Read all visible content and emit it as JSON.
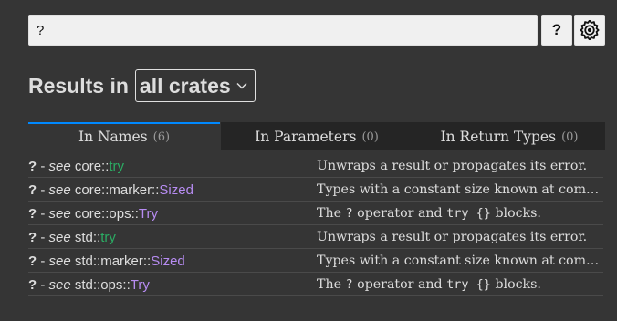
{
  "search": {
    "value": "?",
    "help_label": "?"
  },
  "heading": {
    "prefix": "Results in",
    "crate_filter": "all crates"
  },
  "tabs": [
    {
      "label": "In Names",
      "count": "(6)",
      "selected": true
    },
    {
      "label": "In Parameters",
      "count": "(0)",
      "selected": false
    },
    {
      "label": "In Return Types",
      "count": "(0)",
      "selected": false
    }
  ],
  "results": [
    {
      "name": "?",
      "see": "see",
      "module": "core::",
      "item": "try",
      "kind": "fn",
      "desc": "Unwraps a result or propagates its error."
    },
    {
      "name": "?",
      "see": "see",
      "module": "core::marker::",
      "item": "Sized",
      "kind": "trait",
      "desc": "Types with a constant size known at comp..."
    },
    {
      "name": "?",
      "see": "see",
      "module": "core::ops::",
      "item": "Try",
      "kind": "trait",
      "desc_pre": "The ",
      "desc_code1": "?",
      "desc_mid": " operator and ",
      "desc_code2": "try {}",
      "desc_post": " blocks."
    },
    {
      "name": "?",
      "see": "see",
      "module": "std::",
      "item": "try",
      "kind": "fn",
      "desc": "Unwraps a result or propagates its error."
    },
    {
      "name": "?",
      "see": "see",
      "module": "std::marker::",
      "item": "Sized",
      "kind": "trait",
      "desc": "Types with a constant size known at comp..."
    },
    {
      "name": "?",
      "see": "see",
      "module": "std::ops::",
      "item": "Try",
      "kind": "trait",
      "desc_pre": "The ",
      "desc_code1": "?",
      "desc_mid": " operator and ",
      "desc_code2": "try {}",
      "desc_post": " blocks."
    }
  ],
  "colors": {
    "background": "#353535",
    "fn": "#2bab63",
    "trait": "#b78cf2",
    "tab_active": "#0089ff"
  },
  "icons": {
    "settings": "gear-icon"
  }
}
